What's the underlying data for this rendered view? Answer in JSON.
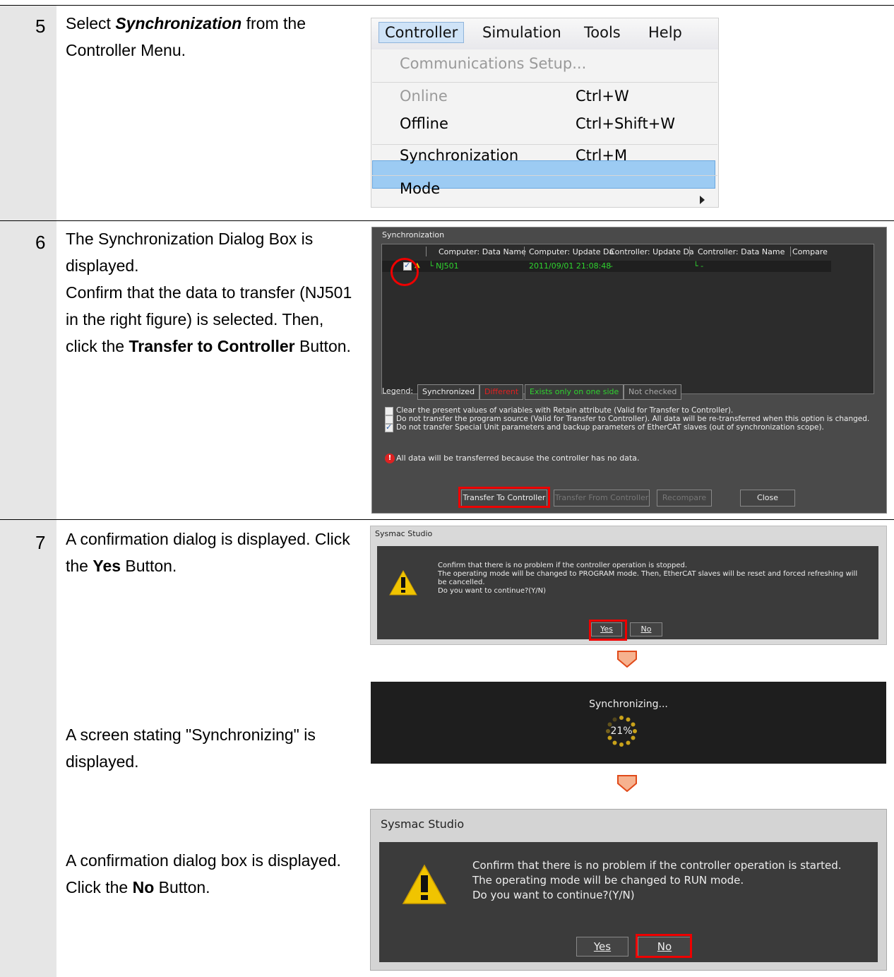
{
  "steps": [
    {
      "num": "5",
      "text_pre": "Select ",
      "text_em": "Synchronization",
      "text_post": " from the Controller Menu."
    },
    {
      "num": "6",
      "line1": "The Synchronization Dialog Box is displayed.",
      "line2": "Confirm that the data to transfer (NJ501 in the right figure) is selected. Then, click the ",
      "bold": "Transfer to Controller",
      "tail": " Button."
    },
    {
      "num": "7",
      "pre": "A confirmation dialog is displayed. Click the ",
      "bold": "Yes",
      "tail": " Button."
    },
    {
      "text": "A screen stating \"Synchronizing\" is displayed."
    },
    {
      "pre": "A confirmation dialog box is displayed. Click the ",
      "bold": "No",
      "tail": " Button."
    }
  ],
  "menu": {
    "bar": [
      "Controller",
      "Simulation",
      "Tools",
      "Help"
    ],
    "items": [
      {
        "label": "Communications Setup...",
        "shortcut": ""
      },
      {
        "label": "Online",
        "shortcut": "Ctrl+W"
      },
      {
        "label": "Offline",
        "shortcut": "Ctrl+Shift+W"
      },
      {
        "label": "Synchronization",
        "shortcut": "Ctrl+M"
      },
      {
        "label": "Mode",
        "shortcut": ""
      }
    ]
  },
  "sync_dialog": {
    "title": "Synchronization",
    "columns": [
      "Computer: Data Name",
      "Computer: Update Da",
      "Controller: Update Da",
      "Controller: Data Name",
      "Compare"
    ],
    "row": {
      "name": "└ NJ501",
      "computer_update": "2011/09/01 21:08:48",
      "controller_update": "-",
      "controller_name": "└ -"
    },
    "legend_label": "Legend:",
    "legend": [
      "Synchronized",
      "Different",
      "Exists only on one side",
      "Not checked"
    ],
    "options": [
      "Clear the present values of variables with Retain attribute (Valid for Transfer to Controller).",
      "Do not transfer the program source (Valid for Transfer to Controller). All data will be re-transferred when this option is changed.",
      "Do not transfer Special Unit parameters and backup parameters of EtherCAT slaves (out of synchronization scope)."
    ],
    "notice": "All data will be transferred because the controller has no data.",
    "buttons": [
      "Transfer To Controller",
      "Transfer From Controller",
      "Recompare",
      "Close"
    ]
  },
  "confirm_stop": {
    "title": "Sysmac Studio",
    "lines": [
      "Confirm that there is no problem if the controller operation is stopped.",
      "The operating mode will be changed to PROGRAM mode. Then, EtherCAT slaves will be reset and forced refreshing will",
      "be cancelled.",
      "Do you want to continue?(Y/N)"
    ],
    "yes": "Yes",
    "no": "No"
  },
  "synchronizing": {
    "label": "Synchronizing...",
    "percent": "21%",
    "progress": 0.21
  },
  "confirm_start": {
    "title": "Sysmac Studio",
    "lines": [
      "Confirm that there is no problem if the controller operation is started.",
      "The operating mode will be changed to RUN mode.",
      "Do you want to continue?(Y/N)"
    ],
    "yes": "Yes",
    "no": "No"
  },
  "colors": {
    "highlight": "#9ccbf3",
    "red_mark": "#e00000",
    "arrow": "#e55a2b",
    "arrow_fill": "#f6b28f"
  }
}
